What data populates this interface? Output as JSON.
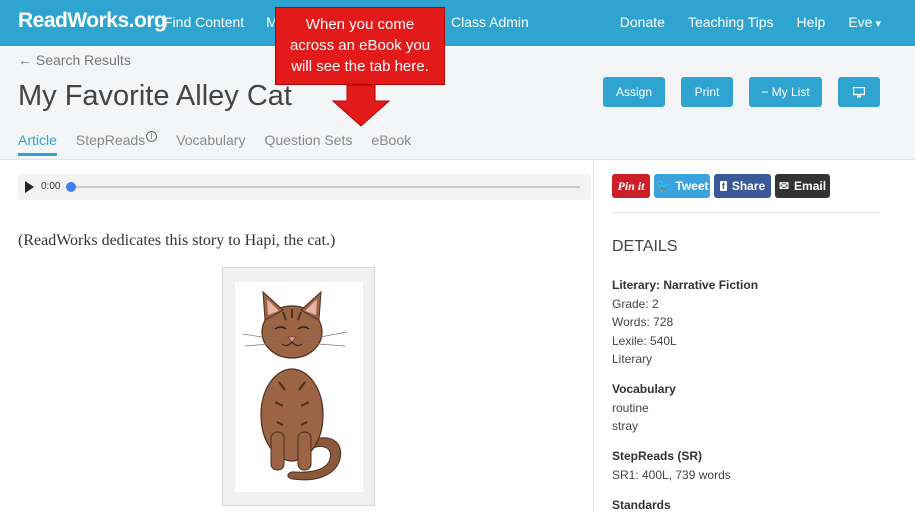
{
  "topbar": {
    "logo": "ReadWorks",
    "logo_tld": ".org",
    "nav_left": [
      "Find Content",
      "My L"
    ],
    "class_admin": "Class Admin",
    "nav_right": [
      "Donate",
      "Teaching Tips",
      "Help",
      "Eve"
    ],
    "user_caret": "▾"
  },
  "header": {
    "back_link": "← Search Results",
    "title": "My Favorite Alley Cat",
    "buttons": {
      "assign": "Assign",
      "print": "Print",
      "my_list": "− My List"
    },
    "tabs": [
      "Article",
      "StepReads",
      "Vocabulary",
      "Question Sets",
      "eBook"
    ]
  },
  "callout": {
    "lines": [
      "When you come",
      "across an eBook you",
      "will see the tab here."
    ]
  },
  "audio": {
    "time": "0:00"
  },
  "article": {
    "dedication": "(ReadWorks dedicates this story to Hapi, the cat.)"
  },
  "share": {
    "pinterest": "Pin it",
    "tweet": "Tweet",
    "facebook": "Share",
    "email": "Email"
  },
  "details": {
    "heading": "DETAILS",
    "genre_title": "Literary: Narrative Fiction",
    "grade": "Grade: 2",
    "words": "Words: 728",
    "lexile": "Lexile: 540L",
    "type": "Literary",
    "vocab_title": "Vocabulary",
    "vocab": [
      "routine",
      "stray"
    ],
    "stepreads_title": "StepReads (SR)",
    "sr1": "SR1: 400L, 739 words",
    "standards_title": "Standards"
  },
  "colors": {
    "brand": "#2fa4d0",
    "callout": "#e21a1a",
    "pinterest": "#cb2027",
    "twitter": "#3ba2e0",
    "facebook": "#3b5998",
    "email": "#333333"
  }
}
